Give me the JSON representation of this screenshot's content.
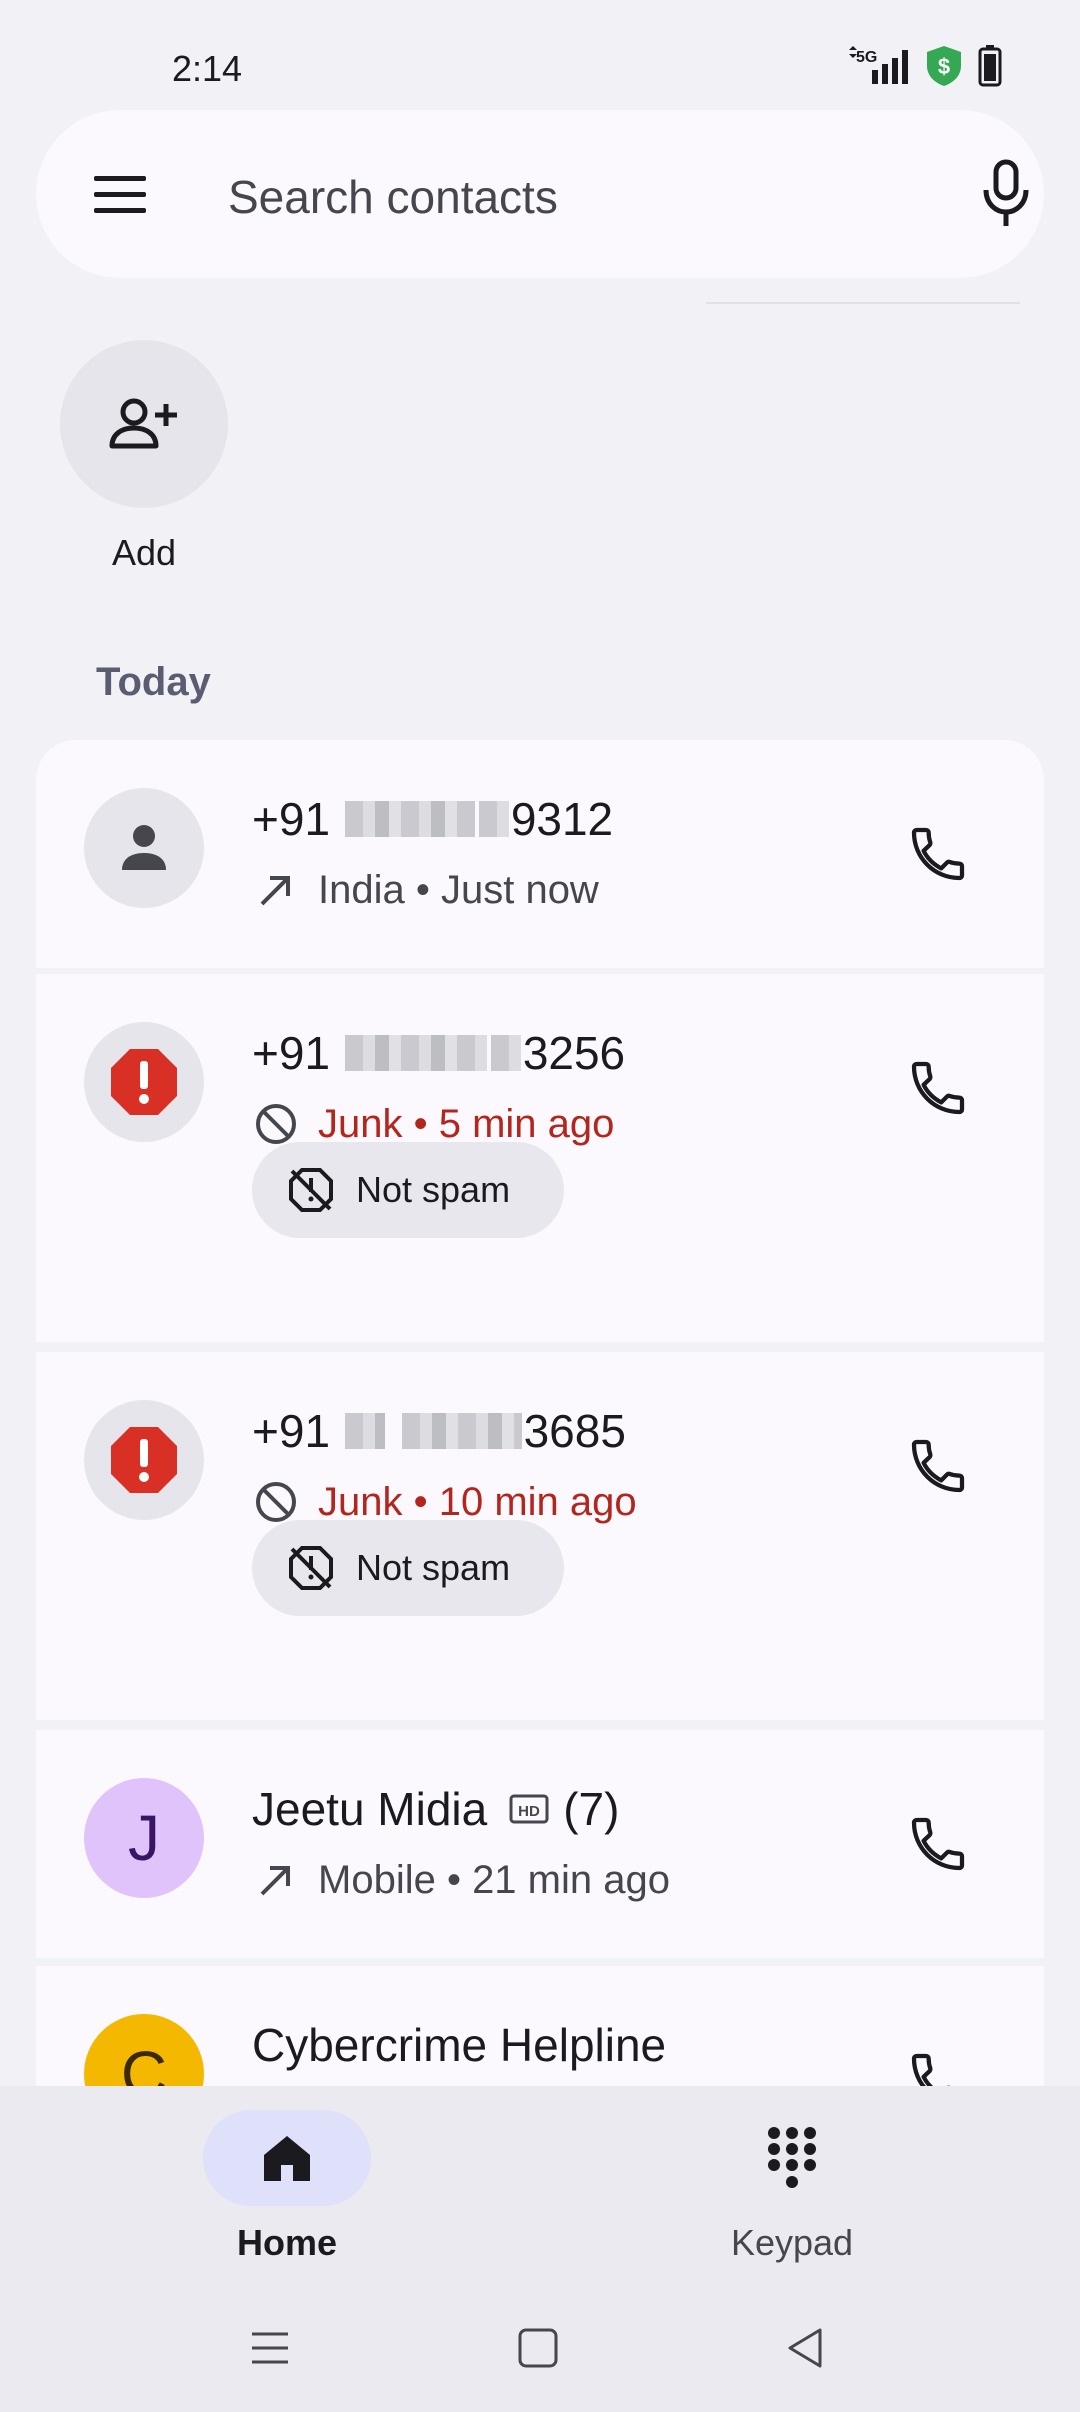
{
  "status": {
    "time": "2:14",
    "network": "5G"
  },
  "search": {
    "placeholder": "Search contacts"
  },
  "favorites": {
    "add_label": "Add"
  },
  "section": {
    "today": "Today"
  },
  "calls": [
    {
      "number_prefix": "+91",
      "number_suffix": "9312",
      "subtitle": "India • Just now",
      "type": "outgoing"
    },
    {
      "number_prefix": "+91",
      "number_suffix": "3256",
      "subtitle": "Junk • 5 min ago",
      "type": "junk",
      "action_label": "Not spam"
    },
    {
      "number_prefix": "+91",
      "number_suffix": "3685",
      "subtitle": "Junk • 10 min ago",
      "type": "junk",
      "action_label": "Not spam"
    },
    {
      "name": "Jeetu Midia",
      "avatar_letter": "J",
      "count": "(7)",
      "subtitle": "Mobile • 21 min ago",
      "type": "outgoing"
    },
    {
      "name": "Cybercrime Helpline",
      "avatar_letter": "C"
    }
  ],
  "nav": {
    "home": "Home",
    "keypad": "Keypad"
  },
  "colors": {
    "junk": "#b3261e",
    "accent": "#dfe0f9",
    "shield": "#34a853"
  }
}
